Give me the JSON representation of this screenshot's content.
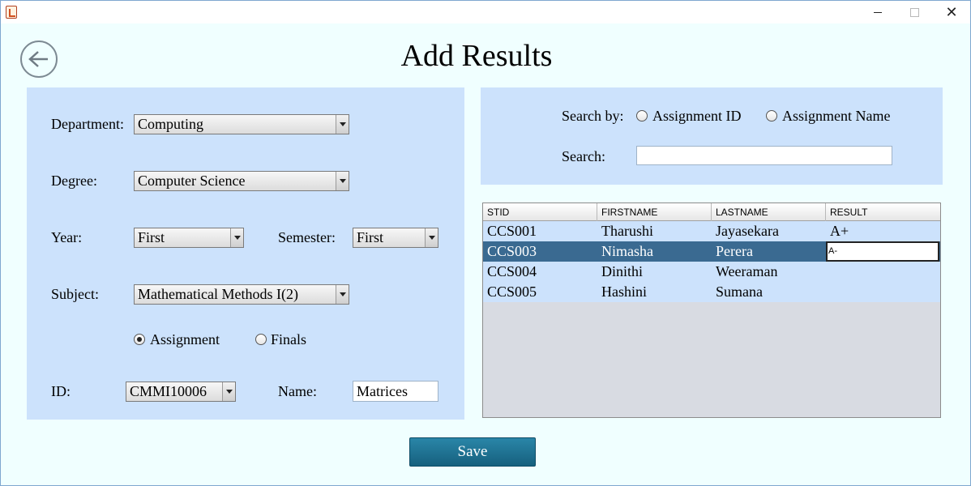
{
  "window": {
    "icon": "java-icon",
    "controls": [
      "minimize",
      "maximize",
      "close"
    ]
  },
  "page": {
    "title": "Add Results",
    "back_icon": "arrow-left-icon"
  },
  "form": {
    "department": {
      "label": "Department:",
      "value": "Computing"
    },
    "degree": {
      "label": "Degree:",
      "value": "Computer Science"
    },
    "year": {
      "label": "Year:",
      "value": "First"
    },
    "semester": {
      "label": "Semester:",
      "value": "First"
    },
    "subject": {
      "label": "Subject:",
      "value": "Mathematical Methods I(2)"
    },
    "type_options": [
      {
        "label": "Assignment",
        "checked": true
      },
      {
        "label": "Finals",
        "checked": false
      }
    ],
    "id": {
      "label": "ID:",
      "value": "CMMI10006"
    },
    "name": {
      "label": "Name:",
      "value": "Matrices"
    }
  },
  "search": {
    "by_label": "Search by:",
    "options": [
      {
        "label": "Assignment ID",
        "checked": false
      },
      {
        "label": "Assignment Name",
        "checked": false
      }
    ],
    "label": "Search:",
    "value": ""
  },
  "table": {
    "columns": [
      "STID",
      "FIRSTNAME",
      "LASTNAME",
      "RESULT"
    ],
    "rows": [
      [
        "CCS001",
        "Tharushi",
        "Jayasekara",
        "A+"
      ],
      [
        "CCS003",
        "Nimasha",
        "Perera",
        "A-"
      ],
      [
        "CCS004",
        "Dinithi",
        "Weeraman",
        ""
      ],
      [
        "CCS005",
        "Hashini",
        "Sumana",
        ""
      ]
    ],
    "selected_row": 1
  },
  "save_label": "Save",
  "colors": {
    "background": "#f0ffff",
    "panel": "#cce2fc",
    "selected_row": "#3a6a91",
    "save_button": "#1d6f8f"
  }
}
